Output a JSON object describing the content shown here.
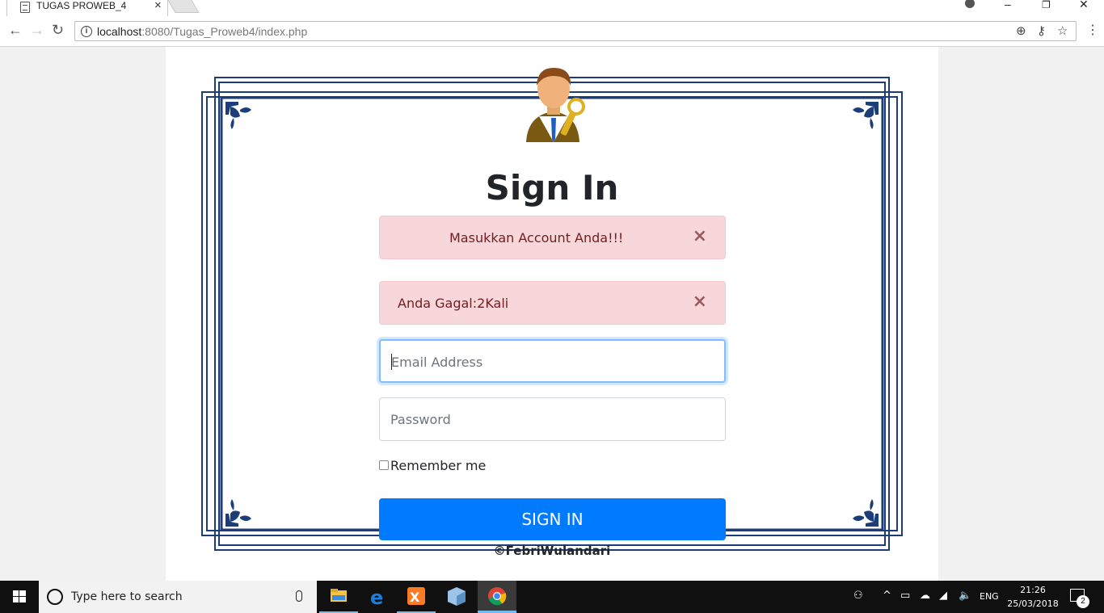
{
  "browser": {
    "tab_title": "TUGAS PROWEB_4",
    "tab_close": "×",
    "url_host": "localhost",
    "url_rest": ":8080/Tugas_Proweb4/index.php",
    "window_controls": [
      "–",
      "❐",
      "✕"
    ]
  },
  "page": {
    "title": "Sign In",
    "alerts": [
      {
        "text": "Masukkan Account Anda!!!",
        "close": "×"
      },
      {
        "text": "Anda Gagal:2Kali",
        "close": "×"
      }
    ],
    "email_placeholder": "Email Address",
    "password_placeholder": "Password",
    "remember_label": "Remember me",
    "signin_label": "SIGN IN",
    "footer": "©FebriWulandari"
  },
  "taskbar": {
    "search_placeholder": "Type here to search",
    "language": "ENG",
    "time": "21:26",
    "date": "25/03/2018",
    "notification_count": "2"
  },
  "colors": {
    "frame": "#1b3e7a",
    "alert_bg": "#f8d7da",
    "alert_text": "#721c24",
    "primary": "#007bff"
  }
}
